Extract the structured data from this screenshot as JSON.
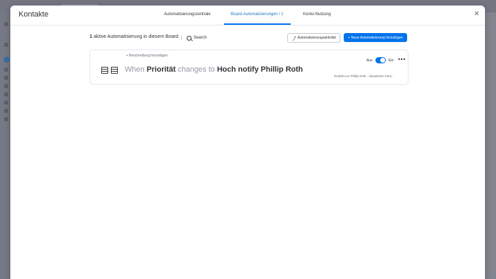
{
  "modal": {
    "title": "Kontakte",
    "close_glyph": "✕",
    "tabs": [
      {
        "label": "Automatisierungszentrale",
        "active": false
      },
      {
        "label": "Board-Automatisierungen / 1",
        "active": true
      },
      {
        "label": "Konto-Nutzung",
        "active": false
      }
    ]
  },
  "toolbar": {
    "count": "1",
    "count_suffix": "aktive Automatisierung in diesem Board",
    "search_label": "Search",
    "activity_label": "Automatisierungsaktivität",
    "new_label": "+ Neue Automatisierung hinzufügen"
  },
  "automation": {
    "add_description": "+ Beschreibung hinzufügen",
    "recipe": {
      "when": "When",
      "column": "Priorität",
      "changes_to": "changes to",
      "value": "Hoch",
      "action": "notify Phillip Roth"
    },
    "toggle_off_label": "Aus",
    "toggle_on_label": "Ein",
    "toggle_state": "on",
    "more_glyph": "•••",
    "meta": "Erstellt von Phillip Roth · Aktualisiert Gera..."
  },
  "colors": {
    "accent": "#0073ea",
    "text": "#323338",
    "muted": "#9699a6"
  }
}
